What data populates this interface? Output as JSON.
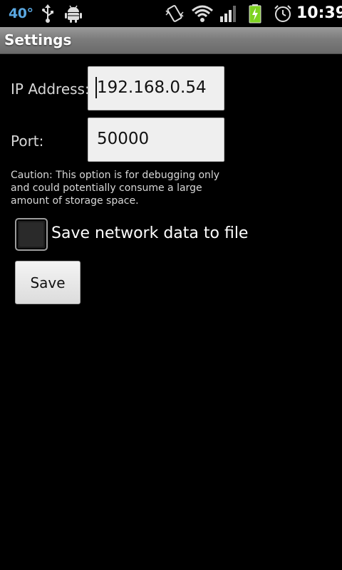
{
  "status_bar": {
    "temperature": "40°",
    "time": "10:39",
    "icons": [
      "usb-icon",
      "android-debug-icon",
      "vibrate-icon",
      "wifi-icon",
      "signal-icon",
      "battery-charging-icon",
      "alarm-icon"
    ]
  },
  "title_bar": {
    "title": "Settings"
  },
  "form": {
    "ip_label": "IP Address:",
    "ip_value": "192.168.0.54",
    "port_label": "Port:",
    "port_value": "50000",
    "caution_text": "Caution: This option is for debugging only and could potentially consume a large amount of storage space.",
    "save_network_label": "Save network data to file",
    "save_network_checked": false,
    "save_button_label": "Save"
  },
  "colors": {
    "background": "#000000",
    "title_bar": "#7c7c7c",
    "temperature": "#5aa7e0",
    "battery": "#7ed321"
  }
}
